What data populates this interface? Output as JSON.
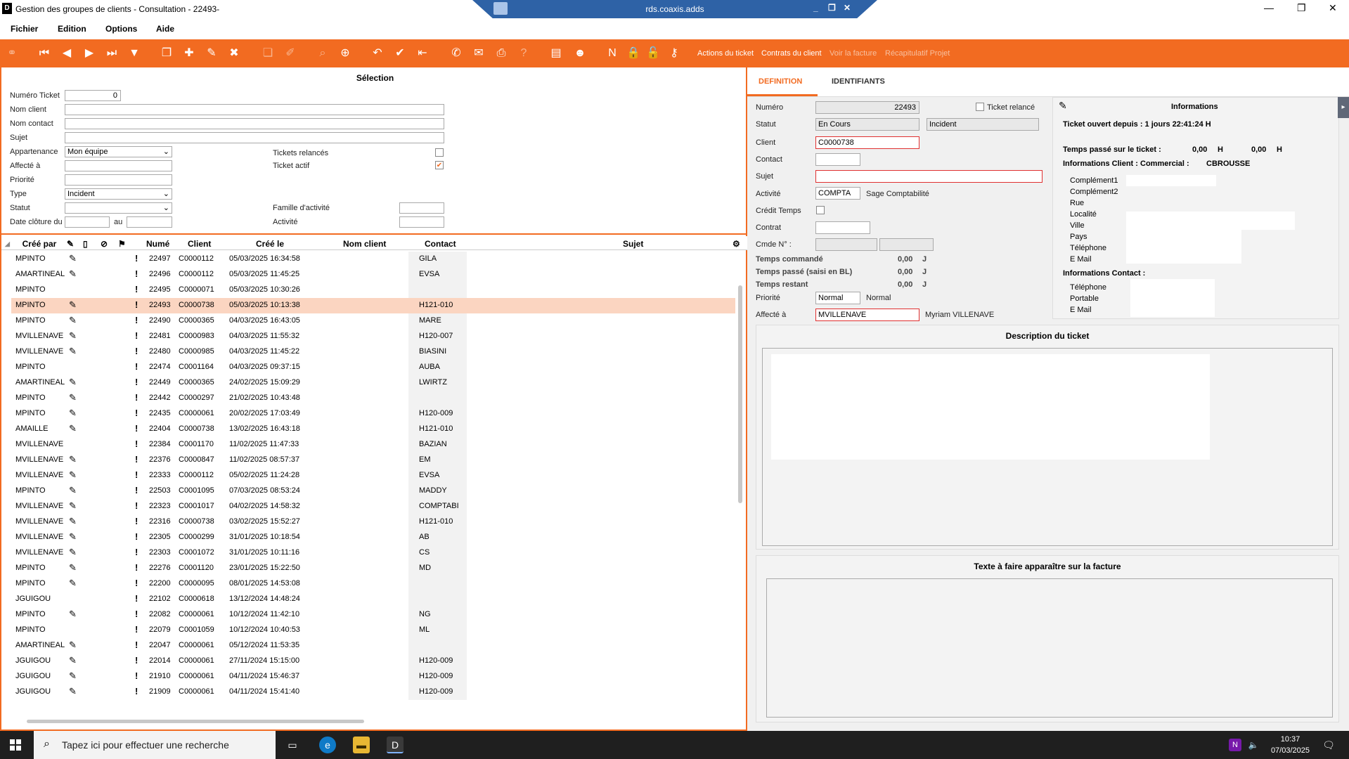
{
  "window": {
    "title": "Gestion des groupes de clients - Consultation - 22493-",
    "rds_host": "rds.coaxis.adds"
  },
  "menu": {
    "items": [
      "Fichier",
      "Edition",
      "Options",
      "Aide"
    ]
  },
  "toolbar": {
    "actions_ticket": "Actions du ticket",
    "contrats_client": "Contrats du client",
    "voir_facture": "Voir la facture",
    "recap_projet": "Récapitulatif Projet"
  },
  "selection": {
    "title": "Sélection",
    "numero_ticket_label": "Numéro Ticket",
    "numero_ticket_value": "0",
    "nom_client_label": "Nom client",
    "nom_contact_label": "Nom contact",
    "sujet_label": "Sujet",
    "appartenance_label": "Appartenance",
    "appartenance_value": "Mon équipe",
    "affecte_label": "Affecté à",
    "priorite_label": "Priorité",
    "type_label": "Type",
    "type_value": "Incident",
    "statut_label": "Statut",
    "date_cloture_label": "Date clôture du",
    "au_label": "au",
    "tickets_relances_label": "Tickets relancés",
    "ticket_actif_label": "Ticket actif",
    "famille_activite_label": "Famille d'activité",
    "activite_label": "Activité"
  },
  "grid": {
    "columns": {
      "cree_par": "Créé par",
      "numero": "Numé",
      "client": "Client",
      "cree_le": "Créé le",
      "nom_client": "Nom client",
      "contact": "Contact",
      "sujet": "Sujet"
    },
    "rows": [
      {
        "by": "MPINTO",
        "num": "22497",
        "client": "C0000112",
        "date": "05/03/2025 16:34:58",
        "contact": "GILA",
        "edit": true
      },
      {
        "by": "AMARTINEAL",
        "num": "22496",
        "client": "C0000112",
        "date": "05/03/2025 11:45:25",
        "contact": "EVSA",
        "edit": true
      },
      {
        "by": "MPINTO",
        "num": "22495",
        "client": "C0000071",
        "date": "05/03/2025 10:30:26",
        "contact": "",
        "edit": false
      },
      {
        "by": "MPINTO",
        "num": "22493",
        "client": "C0000738",
        "date": "05/03/2025 10:13:38",
        "contact": "H121-010",
        "edit": true,
        "selected": true
      },
      {
        "by": "MPINTO",
        "num": "22490",
        "client": "C0000365",
        "date": "04/03/2025 16:43:05",
        "contact": "MARE",
        "edit": true
      },
      {
        "by": "MVILLENAVE",
        "num": "22481",
        "client": "C0000983",
        "date": "04/03/2025 11:55:32",
        "contact": "H120-007",
        "edit": true
      },
      {
        "by": "MVILLENAVE",
        "num": "22480",
        "client": "C0000985",
        "date": "04/03/2025 11:45:22",
        "contact": "BIASINI",
        "edit": true
      },
      {
        "by": "MPINTO",
        "num": "22474",
        "client": "C0001164",
        "date": "04/03/2025 09:37:15",
        "contact": "AUBA",
        "edit": false
      },
      {
        "by": "AMARTINEAL",
        "num": "22449",
        "client": "C0000365",
        "date": "24/02/2025 15:09:29",
        "contact": "LWIRTZ",
        "edit": true
      },
      {
        "by": "MPINTO",
        "num": "22442",
        "client": "C0000297",
        "date": "21/02/2025 10:43:48",
        "contact": "",
        "edit": true
      },
      {
        "by": "MPINTO",
        "num": "22435",
        "client": "C0000061",
        "date": "20/02/2025 17:03:49",
        "contact": "H120-009",
        "edit": true
      },
      {
        "by": "AMAILLE",
        "num": "22404",
        "client": "C0000738",
        "date": "13/02/2025 16:43:18",
        "contact": "H121-010",
        "edit": true
      },
      {
        "by": "MVILLENAVE",
        "num": "22384",
        "client": "C0001170",
        "date": "11/02/2025 11:47:33",
        "contact": "BAZIAN",
        "edit": false
      },
      {
        "by": "MVILLENAVE",
        "num": "22376",
        "client": "C0000847",
        "date": "11/02/2025 08:57:37",
        "contact": "EM",
        "edit": true
      },
      {
        "by": "MVILLENAVE",
        "num": "22333",
        "client": "C0000112",
        "date": "05/02/2025 11:24:28",
        "contact": "EVSA",
        "edit": true
      },
      {
        "by": "MPINTO",
        "num": "22503",
        "client": "C0001095",
        "date": "07/03/2025 08:53:24",
        "contact": "MADDY",
        "edit": true
      },
      {
        "by": "MVILLENAVE",
        "num": "22323",
        "client": "C0001017",
        "date": "04/02/2025 14:58:32",
        "contact": "COMPTABI",
        "edit": true
      },
      {
        "by": "MVILLENAVE",
        "num": "22316",
        "client": "C0000738",
        "date": "03/02/2025 15:52:27",
        "contact": "H121-010",
        "edit": true
      },
      {
        "by": "MVILLENAVE",
        "num": "22305",
        "client": "C0000299",
        "date": "31/01/2025 10:18:54",
        "contact": "AB",
        "edit": true
      },
      {
        "by": "MVILLENAVE",
        "num": "22303",
        "client": "C0001072",
        "date": "31/01/2025 10:11:16",
        "contact": "CS",
        "edit": true
      },
      {
        "by": "MPINTO",
        "num": "22276",
        "client": "C0001120",
        "date": "23/01/2025 15:22:50",
        "contact": "MD",
        "edit": true
      },
      {
        "by": "MPINTO",
        "num": "22200",
        "client": "C0000095",
        "date": "08/01/2025 14:53:08",
        "contact": "",
        "edit": true
      },
      {
        "by": "JGUIGOU",
        "num": "22102",
        "client": "C0000618",
        "date": "13/12/2024 14:48:24",
        "contact": "",
        "edit": false
      },
      {
        "by": "MPINTO",
        "num": "22082",
        "client": "C0000061",
        "date": "10/12/2024 11:42:10",
        "contact": "NG",
        "edit": true
      },
      {
        "by": "MPINTO",
        "num": "22079",
        "client": "C0001059",
        "date": "10/12/2024 10:40:53",
        "contact": "ML",
        "edit": false
      },
      {
        "by": "AMARTINEAL",
        "num": "22047",
        "client": "C0000061",
        "date": "05/12/2024 11:53:35",
        "contact": "",
        "edit": true
      },
      {
        "by": "JGUIGOU",
        "num": "22014",
        "client": "C0000061",
        "date": "27/11/2024 15:15:00",
        "contact": "H120-009",
        "edit": true
      },
      {
        "by": "JGUIGOU",
        "num": "21910",
        "client": "C0000061",
        "date": "04/11/2024 15:46:37",
        "contact": "H120-009",
        "edit": true
      },
      {
        "by": "JGUIGOU",
        "num": "21909",
        "client": "C0000061",
        "date": "04/11/2024 15:41:40",
        "contact": "H120-009",
        "edit": true
      }
    ]
  },
  "detail": {
    "tabs": [
      "DEFINITION",
      "IDENTIFIANTS"
    ],
    "numero_label": "Numéro",
    "numero_value": "22493",
    "ticket_relance_label": "Ticket relancé",
    "statut_label": "Statut",
    "statut_value": "En Cours",
    "type_value": "Incident",
    "client_label": "Client",
    "client_value": "C0000738",
    "contact_label": "Contact",
    "sujet_label": "Sujet",
    "activite_label": "Activité",
    "activite_code": "COMPTA",
    "activite_name": "Sage Comptabilité",
    "credit_temps_label": "Crédit Temps",
    "contrat_label": "Contrat",
    "cmde_label": "Cmde N° :",
    "temps_commande_label": "Temps commandé",
    "temps_commande_value": "0,00",
    "temps_commande_unit": "J",
    "temps_passe_bl_label": "Temps passé (saisi en BL)",
    "temps_passe_bl_value": "0,00",
    "temps_passe_bl_unit": "J",
    "temps_restant_label": "Temps restant",
    "temps_restant_value": "0,00",
    "temps_restant_unit": "J",
    "priorite_label": "Priorité",
    "priorite_value": "Normal",
    "priorite_text": "Normal",
    "affecte_label": "Affecté à",
    "affecte_value": "MVILLENAVE",
    "affecte_name": "Myriam VILLENAVE"
  },
  "info": {
    "title": "Informations",
    "ouvert_depuis": "Ticket ouvert depuis : 1 jours 22:41:24 H",
    "temps_passe_label": "Temps passé sur le ticket :",
    "temps_passe_1": "0,00",
    "unit_1": "H",
    "temps_passe_2": "0,00",
    "unit_2": "H",
    "info_client_label": "Informations Client : Commercial :",
    "commercial": "CBROUSSE",
    "client_fields": [
      "Complément1",
      "Complément2",
      "Rue",
      "Localité",
      "Ville",
      "Pays",
      "Téléphone",
      "E Mail"
    ],
    "info_contact_label": "Informations Contact :",
    "contact_fields": [
      "Téléphone",
      "Portable",
      "E Mail"
    ]
  },
  "description": {
    "title": "Description du ticket"
  },
  "facture": {
    "title": "Texte à faire apparaître sur la facture"
  },
  "taskbar": {
    "search_placeholder": "Tapez ici pour effectuer une recherche",
    "time": "10:37",
    "date": "07/03/2025"
  },
  "colors": {
    "accent": "#f26b21",
    "selected_row": "#fbd5c1",
    "rds_bar": "#2e62a6"
  }
}
